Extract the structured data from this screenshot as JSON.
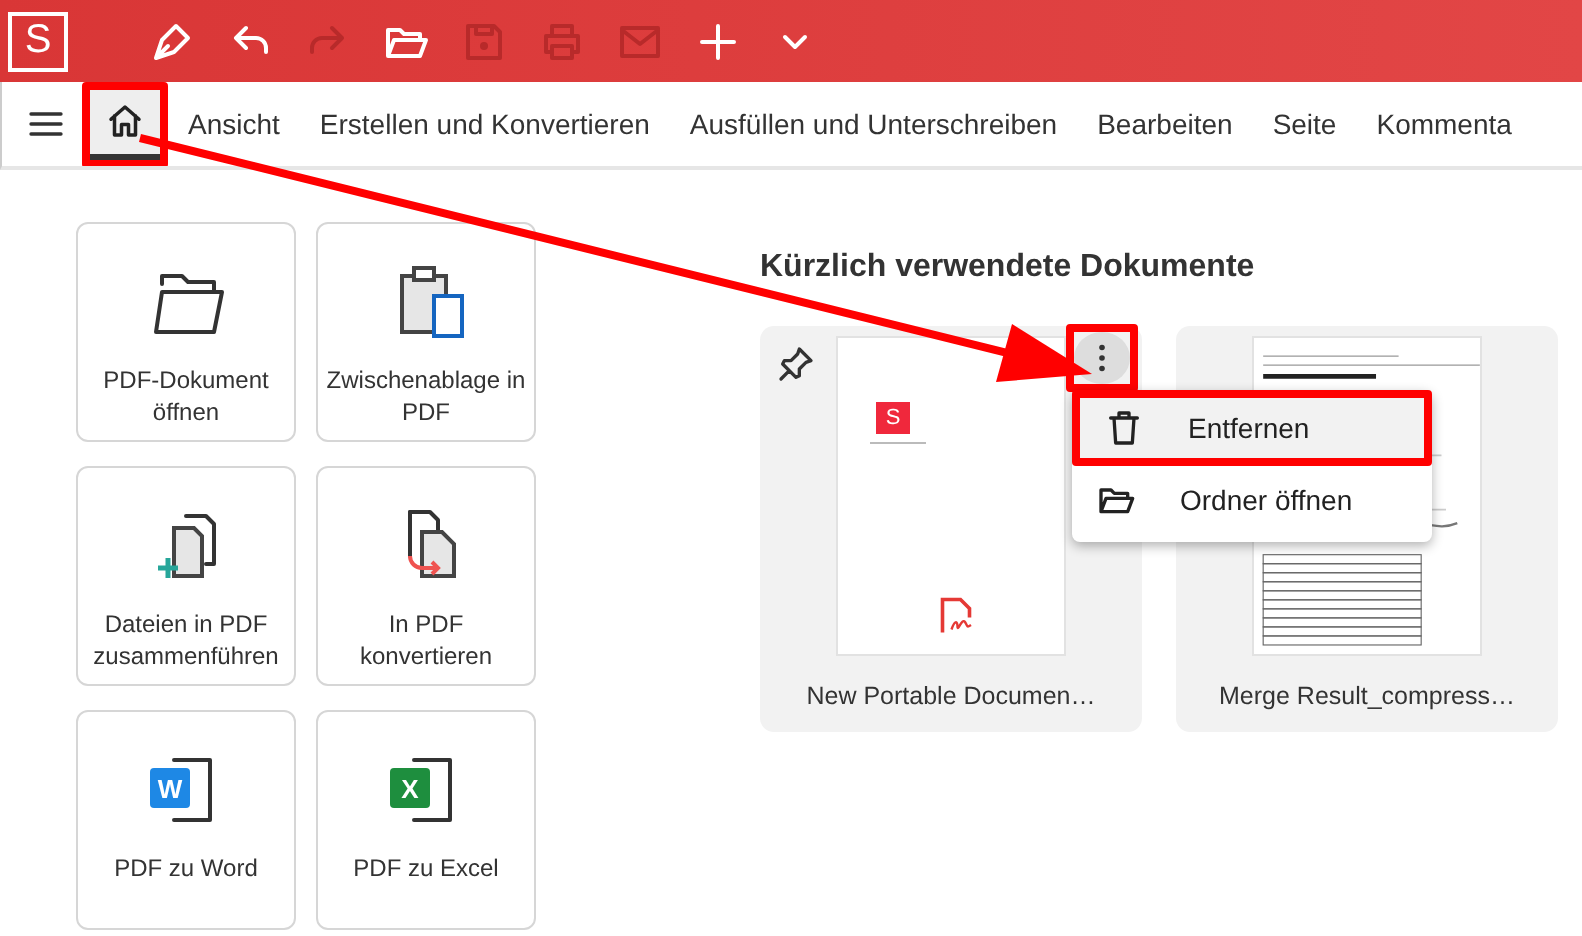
{
  "app": {
    "logo": "S"
  },
  "toolbar": [
    {
      "kind": "pen",
      "disabled": false
    },
    {
      "kind": "undo",
      "disabled": false
    },
    {
      "kind": "redo",
      "disabled": true
    },
    {
      "kind": "open",
      "disabled": false
    },
    {
      "kind": "save",
      "disabled": true
    },
    {
      "kind": "print",
      "disabled": true
    },
    {
      "kind": "mail",
      "disabled": true
    },
    {
      "kind": "new",
      "disabled": false
    },
    {
      "kind": "more",
      "disabled": false
    }
  ],
  "menu_tabs": [
    {
      "kind": "home",
      "selected": true,
      "highlighted": true
    },
    {
      "label": "Ansicht",
      "selected": false,
      "highlighted": false
    },
    {
      "label": "Erstellen und Konvertieren",
      "selected": false,
      "highlighted": false
    },
    {
      "label": "Ausfüllen und Unterschreiben",
      "selected": false,
      "highlighted": false
    },
    {
      "label": "Bearbeiten",
      "selected": false,
      "highlighted": false
    },
    {
      "label": "Seite",
      "selected": false,
      "highlighted": false
    },
    {
      "label": "Kommenta",
      "selected": false,
      "highlighted": false
    }
  ],
  "tiles": [
    {
      "kind": "open",
      "label": "PDF-Dokument öffnen"
    },
    {
      "kind": "clipboard",
      "label": "Zwischenablage in PDF"
    },
    {
      "kind": "merge",
      "label": "Dateien in PDF zusammenführen"
    },
    {
      "kind": "convert",
      "label": "In PDF konvertieren"
    },
    {
      "kind": "word",
      "label": "PDF zu Word",
      "badge": "W"
    },
    {
      "kind": "excel",
      "label": "PDF zu Excel",
      "badge": "X"
    }
  ],
  "recent": {
    "title": "Kürzlich verwendete Dokumente",
    "documents": [
      {
        "name": "New Portable Documen…",
        "logo": "S",
        "pinned": true,
        "menu_open": true,
        "more_highlighted": true
      },
      {
        "name": "Merge Result_compress…",
        "pinned": false,
        "menu_open": false,
        "more_highlighted": false
      }
    ],
    "menu": [
      {
        "kind": "delete",
        "label": "Entfernen",
        "highlighted": true
      },
      {
        "kind": "folder",
        "label": "Ordner öffnen",
        "highlighted": false
      }
    ]
  }
}
